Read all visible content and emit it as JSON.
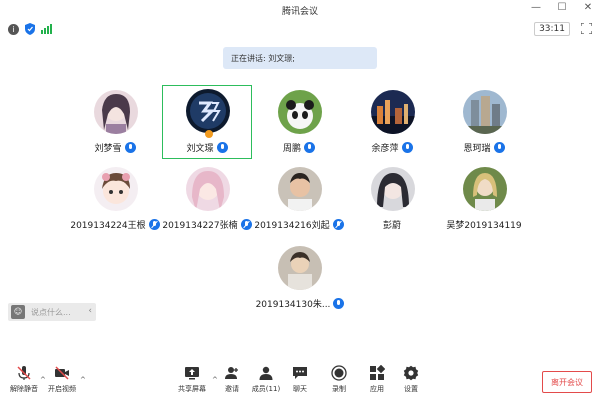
{
  "window": {
    "title": "腾讯会议"
  },
  "status": {
    "timer": "33:11"
  },
  "banner": {
    "speaking_text": "正在讲话: 刘文璟;"
  },
  "participants": [
    {
      "name": "刘梦雪",
      "mic": "on"
    },
    {
      "name": "刘文璟",
      "mic": "on",
      "active": true
    },
    {
      "name": "周鹏",
      "mic": "on"
    },
    {
      "name": "余彦萍",
      "mic": "on"
    },
    {
      "name": "恩珂瑞",
      "mic": "on"
    },
    {
      "name": "2019134224王根",
      "mic": "muted"
    },
    {
      "name": "2019134227张楠",
      "mic": "muted"
    },
    {
      "name": "2019134216刘起",
      "mic": "muted"
    },
    {
      "name": "彭蔚",
      "mic": "none"
    },
    {
      "name": "吴梦2019134119",
      "mic": "none"
    },
    {
      "name": "2019134130朱...",
      "mic": "on"
    }
  ],
  "chat": {
    "placeholder": "说点什么..."
  },
  "toolbar": {
    "unmute": "解除静音",
    "video": "开启视频",
    "share": "共享屏幕",
    "invite": "邀请",
    "members": "成员(11)",
    "chat": "聊天",
    "record": "录制",
    "apps": "应用",
    "settings": "设置",
    "leave": "离开会议"
  },
  "colors": {
    "accent": "#1a73e8",
    "active_border": "#2dbd5c",
    "leave": "#e34b4b",
    "signal": "#22b14c"
  }
}
